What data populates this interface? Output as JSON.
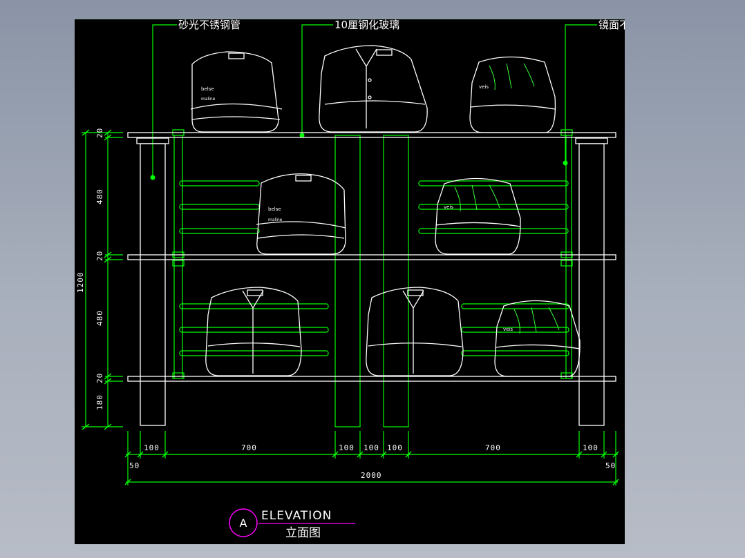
{
  "callouts": {
    "left": "砂光不锈钢管",
    "center": "10厘钢化玻璃",
    "right": "镜面不锈钢管"
  },
  "dimensions": {
    "vertical": {
      "shelf1": "20",
      "gap1": "480",
      "shelf2": "20",
      "gap2": "480",
      "shelf3": "20",
      "base": "180",
      "total": "1200"
    },
    "horizontal": {
      "h1": "100",
      "h2": "700",
      "h3": "100",
      "h4": "100",
      "h5": "100",
      "h6": "700",
      "h7": "100",
      "edge_left": "50",
      "edge_right": "50",
      "total": "2000"
    }
  },
  "garment_labels": {
    "brand_a": "belse",
    "brand_a2": "maline",
    "brand_b": "veis"
  },
  "title_block": {
    "letter": "A",
    "title": "ELEVATION",
    "subtitle": "立面图"
  },
  "colors": {
    "background": "#000000",
    "structure": "#00ff00",
    "outline": "#ffffff",
    "title_circle": "#ff00ff"
  }
}
